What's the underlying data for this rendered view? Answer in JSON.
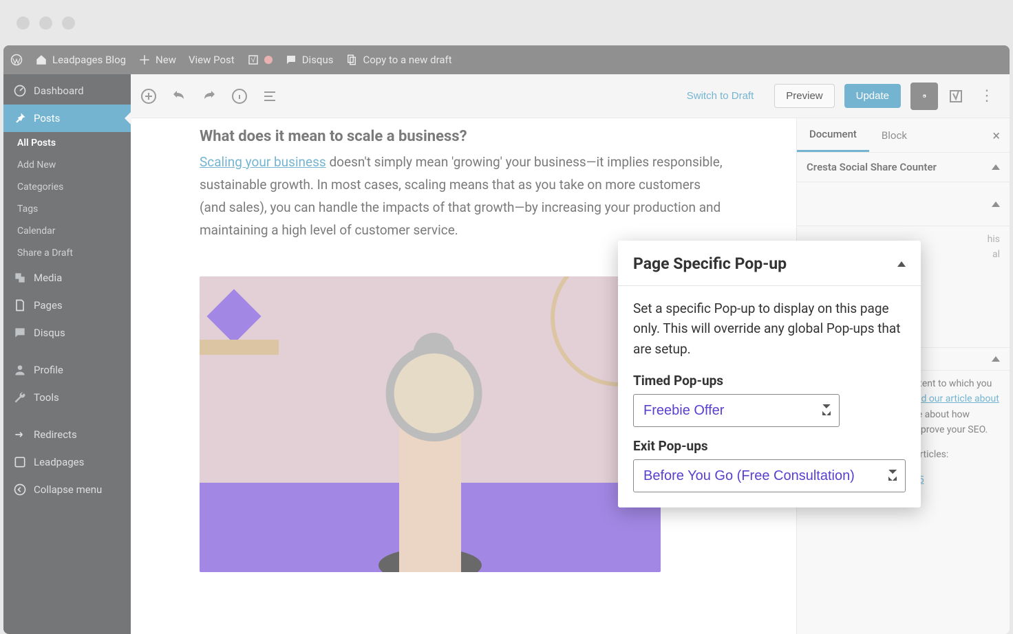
{
  "top_bar": {
    "site_name": "Leadpages Blog",
    "new": "New",
    "view_post": "View Post",
    "disqus": "Disqus",
    "copy_draft": "Copy to a new draft"
  },
  "sidebar": {
    "dashboard": "Dashboard",
    "posts": "Posts",
    "posts_sub": [
      "All Posts",
      "Add New",
      "Categories",
      "Tags",
      "Calendar",
      "Share a Draft"
    ],
    "media": "Media",
    "pages": "Pages",
    "disqus": "Disqus",
    "profile": "Profile",
    "tools": "Tools",
    "redirects": "Redirects",
    "leadpages": "Leadpages",
    "collapse": "Collapse menu"
  },
  "editor_bar": {
    "switch_draft": "Switch to Draft",
    "preview": "Preview",
    "update": "Update"
  },
  "article": {
    "heading": "What does it mean to scale a business?",
    "link_text": "Scaling your business",
    "body_after_link": " doesn't simply mean 'growing' your business—it implies responsible, sustainable growth. In most cases, scaling means that as you take on more customers (and sales), you can handle the impacts of that growth—by increasing your production and maintaining a high level of customer service."
  },
  "inspector": {
    "tabs": {
      "document": "Document",
      "block": "Block"
    },
    "panel_cresta": "Cresta Social Share Counter",
    "related_intro": "This is a list of related content to which you could link in your post. ",
    "related_link": "Read our article about site structure",
    "related_after": " to learn more about how internal linking can help improve your SEO.",
    "consider": "Consider linking to these articles:",
    "article_link": "The Rise of Product Hunt: 5"
  },
  "popup": {
    "title": "Page Specific Pop-up",
    "description": "Set a specific Pop-up to display on this page only. This will override any global Pop-ups that are setup.",
    "timed_label": "Timed Pop-ups",
    "timed_value": "Freebie Offer",
    "exit_label": "Exit Pop-ups",
    "exit_value": "Before You Go (Free Consultation)"
  }
}
